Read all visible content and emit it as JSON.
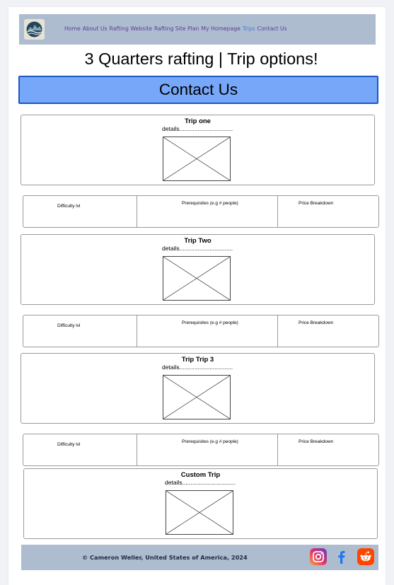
{
  "nav": {
    "links": [
      "Home",
      "About Us",
      "Rafting Website",
      "Rafting Site Plan",
      "My Homepage",
      "Trips",
      "Contact Us"
    ],
    "active": "Trips"
  },
  "site_title": "3 Quarters rafting | Trip options!",
  "contact_button": "Contact Us",
  "trips": [
    {
      "title": "Trip one",
      "details": "details................................"
    },
    {
      "title": "Trip Two",
      "details": "details................................"
    },
    {
      "title": "Trip Trip 3",
      "details": "details................................"
    },
    {
      "title": "Custom Trip",
      "details": "details................................"
    }
  ],
  "info_row": {
    "difficulty": "Difficulty lvl",
    "prerequisites": "Prerequisites (e.g # people)",
    "price": "Price Breakdown"
  },
  "footer": {
    "copyright": "© Cameron Weller, United States of America, 2024",
    "social_icons": [
      "instagram-icon",
      "facebook-icon",
      "reddit-icon"
    ]
  },
  "colors": {
    "nav_bg": "#aebcd0",
    "contact_bg": "#76a7f9",
    "contact_border": "#1e57c4",
    "nav_link": "#5a3f8e",
    "nav_active": "#3f7fd4"
  }
}
